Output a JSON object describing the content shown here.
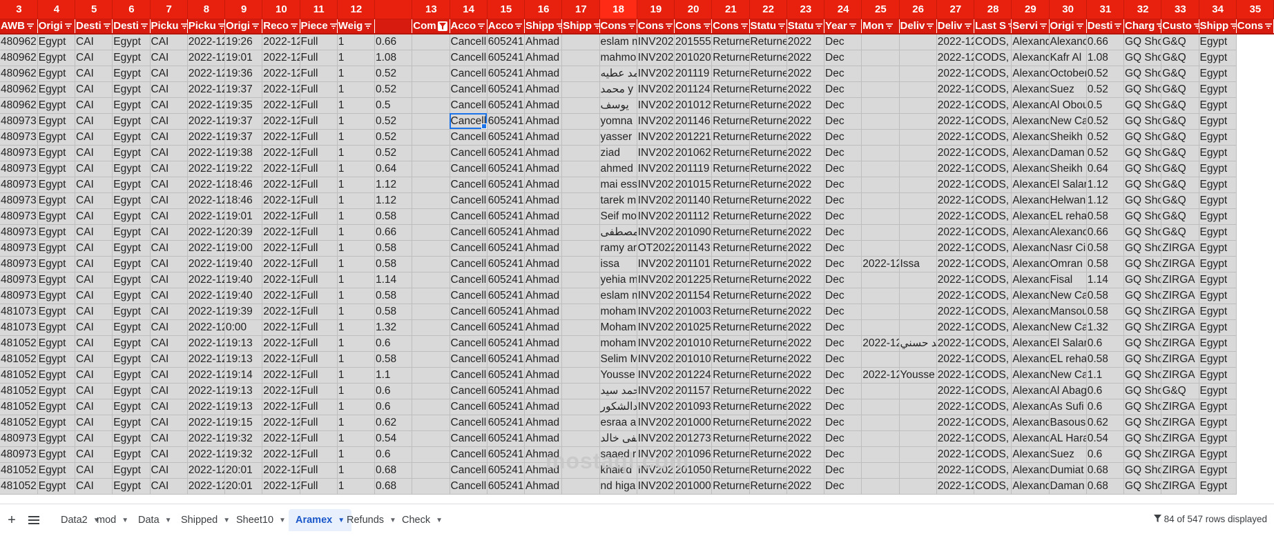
{
  "columns": [
    {
      "num": "3",
      "header": "AWB",
      "w": 53,
      "filter": false,
      "sel": false
    },
    {
      "num": "4",
      "header": "Origi",
      "w": 53,
      "filter": true,
      "sel": false
    },
    {
      "num": "5",
      "header": "Desti",
      "w": 53,
      "filter": true,
      "sel": false
    },
    {
      "num": "6",
      "header": "Desti",
      "w": 53,
      "filter": true,
      "sel": false
    },
    {
      "num": "7",
      "header": "Picku",
      "w": 53,
      "filter": true,
      "sel": false
    },
    {
      "num": "8",
      "header": "Picku",
      "w": 53,
      "filter": true,
      "sel": false
    },
    {
      "num": "9",
      "header": "Origi",
      "w": 53,
      "filter": true,
      "sel": false
    },
    {
      "num": "10",
      "header": "Reco",
      "w": 53,
      "filter": true,
      "sel": false
    },
    {
      "num": "11",
      "header": "Piece",
      "w": 53,
      "filter": true,
      "sel": false
    },
    {
      "num": "12",
      "header": "Weig",
      "w": 53,
      "filter": true,
      "sel": false
    },
    {
      "num": "",
      "header": "",
      "w": 53,
      "filter": false,
      "sel": false
    },
    {
      "num": "13",
      "header": "Com",
      "w": 53,
      "filter": false,
      "filterButton": true,
      "sel": false
    },
    {
      "num": "14",
      "header": "Acco",
      "w": 53,
      "filter": true,
      "sel": false
    },
    {
      "num": "15",
      "header": "Acco",
      "w": 53,
      "filter": true,
      "sel": false
    },
    {
      "num": "16",
      "header": "Shipp",
      "w": 53,
      "filter": true,
      "sel": false
    },
    {
      "num": "17",
      "header": "Shipp",
      "w": 53,
      "filter": true,
      "sel": false
    },
    {
      "num": "18",
      "header": "Cons",
      "w": 53,
      "filter": true,
      "sel": true
    },
    {
      "num": "19",
      "header": "Cons",
      "w": 53,
      "filter": true,
      "sel": false
    },
    {
      "num": "20",
      "header": "Cons",
      "w": 53,
      "filter": true,
      "sel": false
    },
    {
      "num": "21",
      "header": "Cons",
      "w": 53,
      "filter": true,
      "sel": false
    },
    {
      "num": "22",
      "header": "Statu",
      "w": 53,
      "filter": true,
      "sel": false
    },
    {
      "num": "23",
      "header": "Statu",
      "w": 53,
      "filter": true,
      "sel": false
    },
    {
      "num": "24",
      "header": "Year",
      "w": 53,
      "filter": true,
      "sel": false
    },
    {
      "num": "25",
      "header": "Mon",
      "w": 53,
      "filter": true,
      "sel": false
    },
    {
      "num": "26",
      "header": "Deliv",
      "w": 53,
      "filter": true,
      "sel": false
    },
    {
      "num": "27",
      "header": "Deliv",
      "w": 53,
      "filter": true,
      "sel": false
    },
    {
      "num": "28",
      "header": "Last S",
      "w": 53,
      "filter": true,
      "sel": false
    },
    {
      "num": "29",
      "header": "Servi",
      "w": 53,
      "filter": true,
      "sel": false
    },
    {
      "num": "30",
      "header": "Origi",
      "w": 53,
      "filter": true,
      "sel": false
    },
    {
      "num": "31",
      "header": "Desti",
      "w": 53,
      "filter": true,
      "sel": false
    },
    {
      "num": "32",
      "header": "Charg",
      "w": 53,
      "filter": true,
      "sel": false
    },
    {
      "num": "33",
      "header": "Custo",
      "w": 53,
      "filter": true,
      "sel": false
    },
    {
      "num": "34",
      "header": "Shipp",
      "w": 53,
      "filter": true,
      "sel": false
    },
    {
      "num": "35",
      "header": "Cons",
      "w": 53,
      "filter": true,
      "sel": false
    }
  ],
  "rows": [
    [
      "480962",
      "Egypt",
      "CAI",
      "Egypt",
      "CAI",
      "2022-12",
      "19:26",
      "2022-12",
      "Full",
      "1",
      "0.66",
      "",
      "Cancell",
      "605241",
      "Ahmad Abdalla",
      "",
      "eslam m",
      "INV202212100",
      "201555",
      "Returne",
      "Returne",
      "2022",
      "Dec",
      "",
      "",
      "2022-12",
      "CODS,",
      "Alexand",
      "Alexand",
      "0.66",
      "GQ Sho",
      "G&Q",
      "Egypt"
    ],
    [
      "480962",
      "Egypt",
      "CAI",
      "Egypt",
      "CAI",
      "2022-12",
      "19:01",
      "2022-12",
      "Full",
      "1",
      "1.08",
      "",
      "Cancell",
      "605241",
      "Ahmad Abdalla",
      "",
      "mahmo",
      "INV202212100",
      "201020",
      "Returne",
      "Returne",
      "2022",
      "Dec",
      "",
      "",
      "2022-12",
      "CODS,",
      "Alexand",
      "Kafr Al",
      "1.08",
      "GQ Sho",
      "G&Q",
      "Egypt"
    ],
    [
      "480962",
      "Egypt",
      "CAI",
      "Egypt",
      "CAI",
      "2022-12",
      "19:36",
      "2022-12",
      "Full",
      "1",
      "0.52",
      "",
      "Cancell",
      "605241",
      "Ahmad Abdalla",
      "",
      "حمد عطيه",
      "INV202212200",
      "201119",
      "Returne",
      "Returne",
      "2022",
      "Dec",
      "",
      "",
      "2022-12",
      "CODS,",
      "Alexand",
      "October",
      "0.52",
      "GQ Sho",
      "G&Q",
      "Egypt"
    ],
    [
      "480962",
      "Egypt",
      "CAI",
      "Egypt",
      "CAI",
      "2022-12",
      "19:37",
      "2022-12",
      "Full",
      "1",
      "0.52",
      "",
      "Cancell",
      "605241",
      "Ahmad Abdalla",
      "",
      "محمد y",
      "INV202212200",
      "201124",
      "Returne",
      "Returne",
      "2022",
      "Dec",
      "",
      "",
      "2022-12",
      "CODS,",
      "Alexand",
      "Suez",
      "0.52",
      "GQ Sho",
      "G&Q",
      "Egypt"
    ],
    [
      "480962",
      "Egypt",
      "CAI",
      "Egypt",
      "CAI",
      "2022-12",
      "19:35",
      "2022-12",
      "Full",
      "1",
      "0.5",
      "",
      "Cancell",
      "605241",
      "Ahmad Abdalla",
      "",
      "يوسف",
      "INV202212200",
      "201012",
      "Returne",
      "Returne",
      "2022",
      "Dec",
      "",
      "",
      "2022-12",
      "CODS,",
      "Alexand",
      "Al Obou",
      "0.5",
      "GQ Sho",
      "G&Q",
      "Egypt"
    ],
    [
      "480973",
      "Egypt",
      "CAI",
      "Egypt",
      "CAI",
      "2022-12",
      "19:37",
      "2022-12",
      "Full",
      "1",
      "0.52",
      "",
      "Cancell",
      "605241",
      "Ahmad Abdalla",
      "",
      "yomna",
      "INV202212200",
      "201146",
      "Returne",
      "Returne",
      "2022",
      "Dec",
      "",
      "",
      "2022-12",
      "CODS,",
      "Alexand",
      "New Ca",
      "0.52",
      "GQ Sho",
      "G&Q",
      "Egypt"
    ],
    [
      "480973",
      "Egypt",
      "CAI",
      "Egypt",
      "CAI",
      "2022-12",
      "19:37",
      "2022-12",
      "Full",
      "1",
      "0.52",
      "",
      "Cancell",
      "605241",
      "Ahmad Abdalla",
      "",
      "yasser",
      "INV202212200",
      "201221",
      "Returne",
      "Returne",
      "2022",
      "Dec",
      "",
      "",
      "2022-12",
      "CODS,",
      "Alexand",
      "Sheikh",
      "0.52",
      "GQ Sho",
      "G&Q",
      "Egypt"
    ],
    [
      "480973",
      "Egypt",
      "CAI",
      "Egypt",
      "CAI",
      "2022-12",
      "19:38",
      "2022-12",
      "Full",
      "1",
      "0.52",
      "",
      "Cancell",
      "605241",
      "Ahmad Abdalla",
      "",
      "ziad",
      "INV202212300",
      "201062",
      "Returne",
      "Returne",
      "2022",
      "Dec",
      "",
      "",
      "2022-12",
      "CODS,",
      "Alexand",
      "Daman",
      "0.52",
      "GQ Sho",
      "G&Q",
      "Egypt"
    ],
    [
      "480973",
      "Egypt",
      "CAI",
      "Egypt",
      "CAI",
      "2022-12",
      "19:22",
      "2022-12",
      "Full",
      "1",
      "0.64",
      "",
      "Cancell",
      "605241",
      "Ahmad Abdalla",
      "",
      "ahmed",
      "INV202212400",
      "201119",
      "Returne",
      "Returne",
      "2022",
      "Dec",
      "",
      "",
      "2022-12",
      "CODS,",
      "Alexand",
      "Sheikh",
      "0.64",
      "GQ Sho",
      "G&Q",
      "Egypt"
    ],
    [
      "480973",
      "Egypt",
      "CAI",
      "Egypt",
      "CAI",
      "2022-12",
      "18:46",
      "2022-12",
      "Full",
      "1",
      "1.12",
      "",
      "Cancell",
      "605241",
      "Ahmad Abdalla",
      "",
      "mai ess",
      "INV202212400",
      "201015",
      "Returne",
      "Returne",
      "2022",
      "Dec",
      "",
      "",
      "2022-12",
      "CODS,",
      "Alexand",
      "El Salar",
      "1.12",
      "GQ Sho",
      "G&Q",
      "Egypt"
    ],
    [
      "480973",
      "Egypt",
      "CAI",
      "Egypt",
      "CAI",
      "2022-12",
      "18:46",
      "2022-12",
      "Full",
      "1",
      "1.12",
      "",
      "Cancell",
      "605241",
      "Ahmad Abdalla",
      "",
      "tarek m",
      "INV202212500",
      "201140",
      "Returne",
      "Returne",
      "2022",
      "Dec",
      "",
      "",
      "2022-12",
      "CODS,",
      "Alexand",
      "Helwan",
      "1.12",
      "GQ Sho",
      "G&Q",
      "Egypt"
    ],
    [
      "480973",
      "Egypt",
      "CAI",
      "Egypt",
      "CAI",
      "2022-12",
      "19:01",
      "2022-12",
      "Full",
      "1",
      "0.58",
      "",
      "Cancell",
      "605241",
      "Ahmad Abdalla",
      "",
      "Seif mo",
      "INV202212500",
      "201112",
      "Returne",
      "Returne",
      "2022",
      "Dec",
      "",
      "",
      "2022-12",
      "CODS,",
      "Alexand",
      "EL reha",
      "0.58",
      "GQ Sho",
      "G&Q",
      "Egypt"
    ],
    [
      "480973",
      "Egypt",
      "CAI",
      "Egypt",
      "CAI",
      "2022-12",
      "20:39",
      "2022-12",
      "Full",
      "1",
      "0.66",
      "",
      "Cancell",
      "605241",
      "Ahmad Abdalla",
      "",
      "مصطفى",
      "INV202212500",
      "201090",
      "Returne",
      "Returne",
      "2022",
      "Dec",
      "",
      "",
      "2022-12",
      "CODS,",
      "Alexand",
      "Alexand",
      "0.66",
      "GQ Sho",
      "G&Q",
      "Egypt"
    ],
    [
      "480973",
      "Egypt",
      "CAI",
      "Egypt",
      "CAI",
      "2022-12",
      "19:00",
      "2022-12",
      "Full",
      "1",
      "0.58",
      "",
      "Cancell",
      "605241",
      "Ahmad Abdalla",
      "",
      "ramy ar",
      "OT2022126000",
      "201143",
      "Returne",
      "Returne",
      "2022",
      "Dec",
      "",
      "",
      "2022-12",
      "CODS,",
      "Alexand",
      "Nasr Ci",
      "0.58",
      "GQ Sho",
      "ZIRGA",
      "Egypt"
    ],
    [
      "480973",
      "Egypt",
      "CAI",
      "Egypt",
      "CAI",
      "2022-12",
      "19:40",
      "2022-12",
      "Full",
      "1",
      "0.58",
      "",
      "Cancell",
      "605241",
      "Ahmad Abdalla",
      "",
      "issa",
      "INV202212700",
      "201101",
      "Returne",
      "Returne",
      "2022",
      "Dec",
      "2022-12",
      "Issa",
      "2022-12",
      "CODS,",
      "Alexand",
      "Omran",
      "0.58",
      "GQ Sho",
      "ZIRGA",
      "Egypt"
    ],
    [
      "480973",
      "Egypt",
      "CAI",
      "Egypt",
      "CAI",
      "2022-12",
      "19:40",
      "2022-12",
      "Full",
      "1",
      "1.14",
      "",
      "Cancell",
      "605241",
      "Ahmad Abdalla",
      "",
      "yehia m",
      "INV202212700",
      "201225",
      "Returne",
      "Returne",
      "2022",
      "Dec",
      "",
      "",
      "2022-12",
      "CODS,",
      "Alexand",
      "Fisal",
      "1.14",
      "GQ Sho",
      "ZIRGA",
      "Egypt"
    ],
    [
      "480973",
      "Egypt",
      "CAI",
      "Egypt",
      "CAI",
      "2022-12",
      "19:40",
      "2022-12",
      "Full",
      "1",
      "0.58",
      "",
      "Cancell",
      "605241",
      "Ahmad Abdalla",
      "",
      "eslam m",
      "INV202212700",
      "201154",
      "Returne",
      "Returne",
      "2022",
      "Dec",
      "",
      "",
      "2022-12",
      "CODS,",
      "Alexand",
      "New Ca",
      "0.58",
      "GQ Sho",
      "ZIRGA",
      "Egypt"
    ],
    [
      "481073",
      "Egypt",
      "CAI",
      "Egypt",
      "CAI",
      "2022-12",
      "19:39",
      "2022-12",
      "Full",
      "1",
      "0.58",
      "",
      "Cancell",
      "605241",
      "Ahmad Abdalla",
      "",
      "moham",
      "INV202212700",
      "201003",
      "Returne",
      "Returne",
      "2022",
      "Dec",
      "",
      "",
      "2022-12",
      "CODS,",
      "Alexand",
      "Mansou",
      "0.58",
      "GQ Sho",
      "ZIRGA",
      "Egypt"
    ],
    [
      "481073",
      "Egypt",
      "CAI",
      "Egypt",
      "CAI",
      "2022-12",
      "0:00",
      "2022-12",
      "Full",
      "1",
      "1.32",
      "",
      "Cancell",
      "605241",
      "Ahmad Abdalla",
      "",
      "Moham",
      "INV202212600",
      "201025",
      "Returne",
      "Returne",
      "2022",
      "Dec",
      "",
      "",
      "2022-12",
      "CODS,",
      "Alexand",
      "New Ca",
      "1.32",
      "GQ Sho",
      "ZIRGA",
      "Egypt"
    ],
    [
      "481052",
      "Egypt",
      "CAI",
      "Egypt",
      "CAI",
      "2022-12",
      "19:13",
      "2022-12",
      "Full",
      "1",
      "0.6",
      "",
      "Cancell",
      "605241",
      "Ahmad Abdalla",
      "",
      "moham",
      "INV202212900",
      "201010",
      "Returne",
      "Returne",
      "2022",
      "Dec",
      "2022-12",
      "حمد حسني",
      "2022-12",
      "CODS,",
      "Alexand",
      "El Salar",
      "0.6",
      "GQ Sho",
      "ZIRGA",
      "Egypt"
    ],
    [
      "481052",
      "Egypt",
      "CAI",
      "Egypt",
      "CAI",
      "2022-12",
      "19:13",
      "2022-12",
      "Full",
      "1",
      "0.58",
      "",
      "Cancell",
      "605241",
      "Ahmad Abdalla",
      "",
      "Selim M",
      "INV202212900",
      "201010",
      "Returne",
      "Returne",
      "2022",
      "Dec",
      "",
      "",
      "2022-12",
      "CODS,",
      "Alexand",
      "EL reha",
      "0.58",
      "GQ Sho",
      "ZIRGA",
      "Egypt"
    ],
    [
      "481052",
      "Egypt",
      "CAI",
      "Egypt",
      "CAI",
      "2022-12",
      "19:14",
      "2022-12",
      "Full",
      "1",
      "1.1",
      "",
      "Cancell",
      "605241",
      "Ahmad Abdalla",
      "",
      "Yousse",
      "INV202212900",
      "201224",
      "Returne",
      "Returne",
      "2022",
      "Dec",
      "2022-12",
      "Yousse",
      "2022-12",
      "CODS,",
      "Alexand",
      "New Ca",
      "1.1",
      "GQ Sho",
      "ZIRGA",
      "Egypt"
    ],
    [
      "481052",
      "Egypt",
      "CAI",
      "Egypt",
      "CAI",
      "2022-12",
      "19:13",
      "2022-12",
      "Full",
      "1",
      "0.6",
      "",
      "Cancell",
      "605241",
      "Ahmad Abdalla",
      "",
      "محمد سيد",
      "INV202212900",
      "201157",
      "Returne",
      "Returne",
      "2022",
      "Dec",
      "",
      "",
      "2022-12",
      "CODS,",
      "Alexand",
      "Al Abag",
      "0.6",
      "GQ Sho",
      "G&Q",
      "Egypt"
    ],
    [
      "481052",
      "Egypt",
      "CAI",
      "Egypt",
      "CAI",
      "2022-12",
      "19:13",
      "2022-12",
      "Full",
      "1",
      "0.6",
      "",
      "Cancell",
      "605241",
      "Ahmad Abdalla",
      "",
      "عبدالشكور",
      "INV202212800",
      "201093",
      "Returne",
      "Returne",
      "2022",
      "Dec",
      "",
      "",
      "2022-12",
      "CODS,",
      "Alexand",
      "As Sufi",
      "0.6",
      "GQ Sho",
      "ZIRGA",
      "Egypt"
    ],
    [
      "481052",
      "Egypt",
      "CAI",
      "Egypt",
      "CAI",
      "2022-12",
      "19:15",
      "2022-12",
      "Full",
      "1",
      "0.62",
      "",
      "Cancell",
      "605241",
      "Ahmad Abdalla",
      "",
      "esraa a",
      "INV202212900",
      "201000",
      "Returne",
      "Returne",
      "2022",
      "Dec",
      "",
      "",
      "2022-12",
      "CODS,",
      "Alexand",
      "Basous",
      "0.62",
      "GQ Sho",
      "ZIRGA",
      "Egypt"
    ],
    [
      "480973",
      "Egypt",
      "CAI",
      "Egypt",
      "CAI",
      "2022-12",
      "19:32",
      "2022-12",
      "Full",
      "1",
      "0.54",
      "",
      "Cancell",
      "605241",
      "Ahmad Abdalla",
      "",
      "صطفى خالد",
      "INV202212100",
      "201273",
      "Returne",
      "Returne",
      "2022",
      "Dec",
      "",
      "",
      "2022-12",
      "CODS,",
      "Alexand",
      "AL Hara",
      "0.54",
      "GQ Sho",
      "ZIRGA",
      "Egypt"
    ],
    [
      "480973",
      "Egypt",
      "CAI",
      "Egypt",
      "CAI",
      "2022-12",
      "19:32",
      "2022-12",
      "Full",
      "1",
      "0.6",
      "",
      "Cancell",
      "605241",
      "Ahmad Abdalla",
      "",
      "saaed r",
      "INV202212100",
      "201096",
      "Returne",
      "Returne",
      "2022",
      "Dec",
      "",
      "",
      "2022-12",
      "CODS,",
      "Alexand",
      "Suez",
      "0.6",
      "GQ Sho",
      "ZIRGA",
      "Egypt"
    ],
    [
      "481052",
      "Egypt",
      "CAI",
      "Egypt",
      "CAI",
      "2022-12",
      "20:01",
      "2022-12",
      "Full",
      "1",
      "0.68",
      "",
      "Cancell",
      "605241",
      "Ahmad Abdalla",
      "",
      "khaled",
      "INV202212110",
      "201050",
      "Returne",
      "Returne",
      "2022",
      "Dec",
      "",
      "",
      "2022-12",
      "CODS,",
      "Alexand",
      "Dumiat",
      "0.68",
      "GQ Sho",
      "ZIRGA",
      "Egypt"
    ],
    [
      "481052",
      "Egypt",
      "CAI",
      "Egypt",
      "CAI",
      "2022-12",
      "20:01",
      "2022-12",
      "Full",
      "1",
      "0.68",
      "",
      "Cancell",
      "605241",
      "Ahmad Abdalla",
      "",
      "nd higa",
      "INV202212110",
      "201000",
      "Returne",
      "Returne",
      "2022",
      "Dec",
      "",
      "",
      "2022-12",
      "CODS,",
      "Alexand",
      "Daman",
      "0.68",
      "GQ Sho",
      "ZIRGA",
      "Egypt"
    ]
  ],
  "selected_cell": {
    "row": 5,
    "col": 12
  },
  "watermark": "mostaql.com",
  "tabs": [
    {
      "label": "Data2",
      "active": false
    },
    {
      "label": "mod",
      "active": false
    },
    {
      "label": "Data",
      "active": false
    },
    {
      "label": "Shipped",
      "active": false
    },
    {
      "label": "Sheet10",
      "active": false
    },
    {
      "label": "Aramex",
      "active": true
    },
    {
      "label": "Refunds",
      "active": false
    },
    {
      "label": "Check",
      "active": false
    }
  ],
  "status": {
    "rows_displayed": "84 of 547 rows displayed"
  },
  "icons": {
    "add": "plus-icon",
    "all_sheets": "menu-icon",
    "filter": "filter-icon"
  },
  "colors": {
    "header_red": "#e8210f",
    "cell_gray": "#d9d9d9",
    "active_tab": "#1a57c9"
  }
}
